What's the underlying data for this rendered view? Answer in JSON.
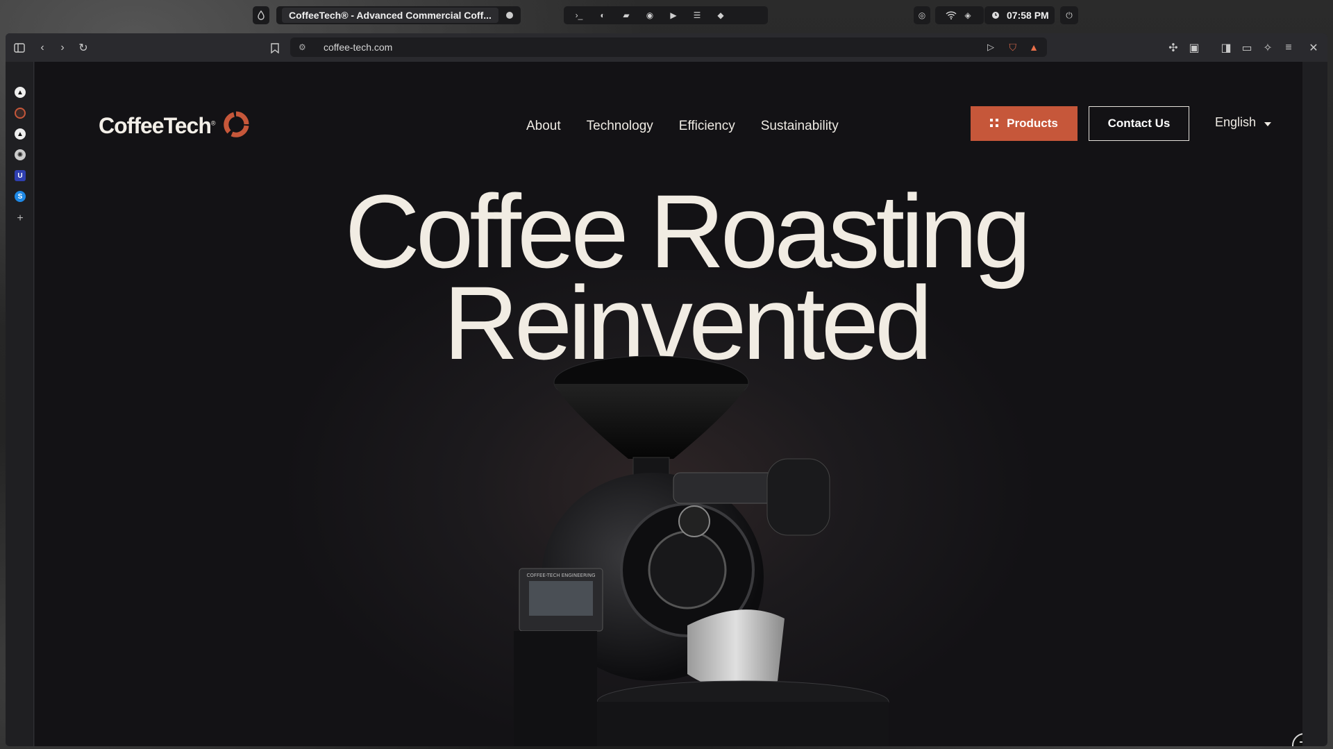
{
  "system": {
    "tab_title": "CoffeeTech® - Advanced Commercial Coff...",
    "time": "07:58 PM"
  },
  "browser": {
    "url": "coffee-tech.com"
  },
  "site": {
    "logo_text": "CoffeeTech",
    "logo_mark": "®",
    "nav": [
      "About",
      "Technology",
      "Efficiency",
      "Sustainability"
    ],
    "products_label": "Products",
    "contact_label": "Contact Us",
    "language": "English",
    "headline_line1": "Coffee Roasting",
    "headline_line2": "Reinvented",
    "machine_label": "COFFEE-TECH ENGINEERING"
  },
  "colors": {
    "accent": "#c6573a",
    "background": "#131215",
    "text": "#f1ece3"
  }
}
